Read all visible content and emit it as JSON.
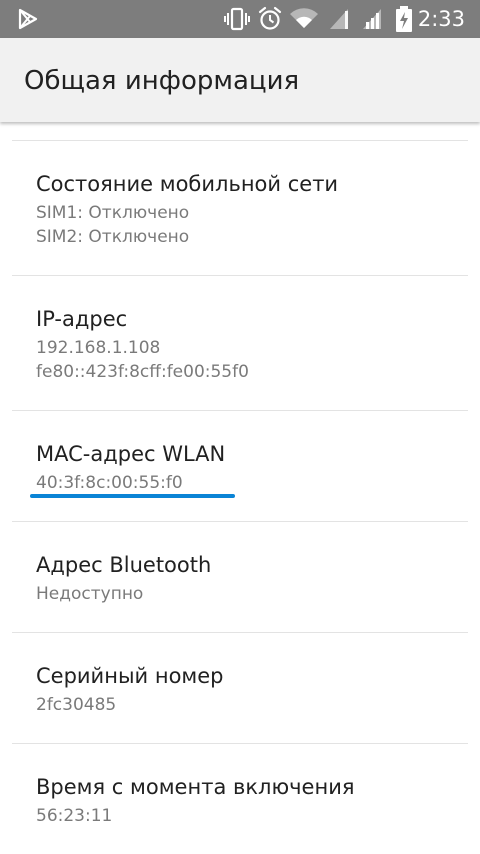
{
  "status_bar": {
    "time": "2:33",
    "icons": [
      "play-store-icon",
      "vibrate-icon",
      "alarm-icon",
      "wifi-icon",
      "signal-sim1-icon",
      "signal-sim2-icon",
      "battery-charging-icon"
    ]
  },
  "header": {
    "title": "Общая информация"
  },
  "items": [
    {
      "title": "Состояние мобильной сети",
      "lines": [
        "SIM1: Отключено",
        "SIM2: Отключено"
      ]
    },
    {
      "title": "IP-адрес",
      "lines": [
        "192.168.1.108",
        "fe80::423f:8cff:fe00:55f0"
      ]
    },
    {
      "title": "MAC-адрес WLAN",
      "lines": [
        "40:3f:8c:00:55:f0"
      ]
    },
    {
      "title": "Адрес Bluetooth",
      "lines": [
        "Недоступно"
      ]
    },
    {
      "title": "Серийный номер",
      "lines": [
        "2fc30485"
      ]
    },
    {
      "title": "Время с момента включения",
      "lines": [
        "56:23:11"
      ]
    }
  ],
  "colors": {
    "status_bar": "#7d7d7d",
    "action_bar": "#f1f1f1",
    "highlight_underline": "#0a84d6",
    "title_text": "#212121",
    "summary_text": "#7a7a7a"
  }
}
